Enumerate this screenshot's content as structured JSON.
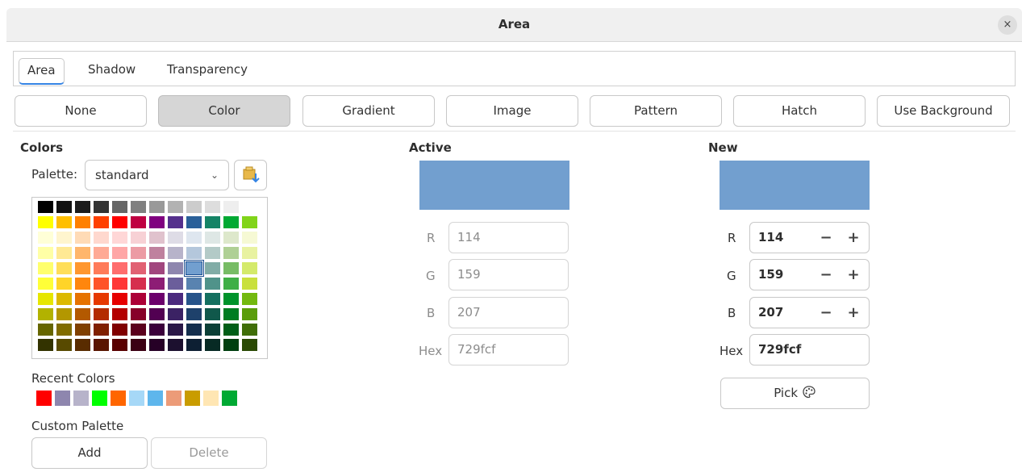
{
  "window": {
    "title": "Area",
    "close_glyph": "×"
  },
  "tabs": [
    {
      "label": "Area",
      "active": true
    },
    {
      "label": "Shadow",
      "active": false
    },
    {
      "label": "Transparency",
      "active": false
    }
  ],
  "fill_buttons": [
    {
      "label": "None",
      "selected": false
    },
    {
      "label": "Color",
      "selected": true
    },
    {
      "label": "Gradient",
      "selected": false
    },
    {
      "label": "Image",
      "selected": false
    },
    {
      "label": "Pattern",
      "selected": false
    },
    {
      "label": "Hatch",
      "selected": false
    },
    {
      "label": "Use Background",
      "selected": false
    }
  ],
  "colors": {
    "heading": "Colors",
    "palette_label": "Palette:",
    "palette_value": "standard",
    "import_icon": "palette-import-icon",
    "grid": [
      [
        "#000000",
        "#111111",
        "#1c1c1c",
        "#333333",
        "#666666",
        "#808080",
        "#999999",
        "#b2b2b2",
        "#cccccc",
        "#dddddd",
        "#eeeeee",
        "#ffffff"
      ],
      [
        "#ffff00",
        "#ffbf00",
        "#ff8000",
        "#ff4000",
        "#ff0000",
        "#bf0041",
        "#800080",
        "#55308d",
        "#2a6099",
        "#158466",
        "#00a933",
        "#81d41a"
      ],
      [
        "#ffffd7",
        "#fff5ce",
        "#ffdbb6",
        "#ffd8ce",
        "#ffd7d7",
        "#f7d1d5",
        "#e0c2cd",
        "#dedce6",
        "#dee6ef",
        "#dee7e5",
        "#dde8cb",
        "#f6f9d4"
      ],
      [
        "#ffffa6",
        "#ffe994",
        "#ffb66c",
        "#ffaa95",
        "#ffa6a6",
        "#ec9ba4",
        "#bf819e",
        "#b7b3ca",
        "#b4c7dc",
        "#b3cac7",
        "#afd095",
        "#e8f2a1"
      ],
      [
        "#ffff6d",
        "#ffde59",
        "#ff972f",
        "#ff7b59",
        "#ff6d6d",
        "#e16173",
        "#a1467e",
        "#8e86ae",
        "#729fcf",
        "#81aca6",
        "#77bc65",
        "#d4ea6b"
      ],
      [
        "#ffff38",
        "#ffd428",
        "#ff860d",
        "#ff5429",
        "#ff3838",
        "#d62e4e",
        "#8d1d75",
        "#6b5e9b",
        "#5983b0",
        "#50938a",
        "#3faf46",
        "#c9e03d"
      ],
      [
        "#e6e600",
        "#dcb900",
        "#e67300",
        "#e63900",
        "#e60000",
        "#ac0037",
        "#6c006c",
        "#4b2a7e",
        "#27548a",
        "#147060",
        "#00932b",
        "#73b90f"
      ],
      [
        "#b2b200",
        "#b39700",
        "#b35900",
        "#b32c00",
        "#b30000",
        "#870029",
        "#520052",
        "#3b2264",
        "#1e416b",
        "#10584b",
        "#007c21",
        "#5a9d0b"
      ],
      [
        "#666600",
        "#806c00",
        "#804000",
        "#802000",
        "#800000",
        "#5b001d",
        "#3b003b",
        "#2a1847",
        "#142e4d",
        "#0b3f36",
        "#005e17",
        "#406e08"
      ],
      [
        "#333300",
        "#584a00",
        "#592c00",
        "#591500",
        "#590000",
        "#3b0013",
        "#260026",
        "#1c102f",
        "#0d1f33",
        "#072a24",
        "#003f0f",
        "#2b4a05"
      ]
    ],
    "selected_cell": [
      4,
      8
    ],
    "recent_label": "Recent Colors",
    "recent": [
      "#ff0000",
      "#8e86ae",
      "#b7b3ca",
      "#00ff00",
      "#ff6600",
      "#a6d8f7",
      "#5eb6ec",
      "#ec9b78",
      "#c99c00",
      "#ffe6b3",
      "#00a933"
    ],
    "custom_label": "Custom Palette",
    "add_label": "Add",
    "delete_label": "Delete"
  },
  "active": {
    "heading": "Active",
    "color": "#729fcf",
    "r_label": "R",
    "r": "114",
    "g_label": "G",
    "g": "159",
    "b_label": "B",
    "b": "207",
    "hex_label": "Hex",
    "hex": "729fcf"
  },
  "new": {
    "heading": "New",
    "color": "#729fcf",
    "r_label": "R",
    "r": "114",
    "g_label": "G",
    "g": "159",
    "b_label": "B",
    "b": "207",
    "hex_label": "Hex",
    "hex": "729fcf",
    "minus_glyph": "−",
    "plus_glyph": "+",
    "pick_label": "Pick",
    "pick_icon": "color-picker-icon"
  }
}
